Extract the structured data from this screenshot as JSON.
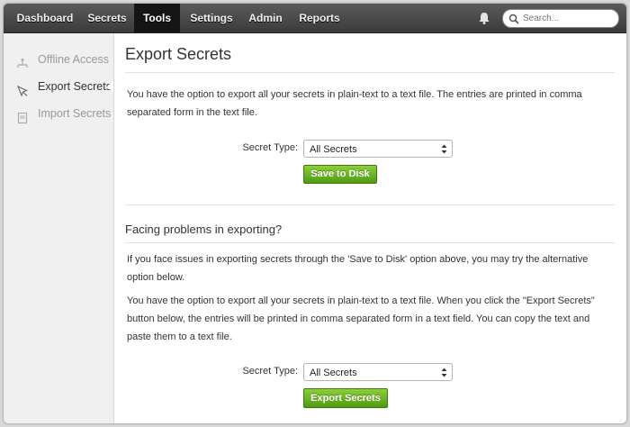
{
  "nav": {
    "items": [
      {
        "label": "Dashboard"
      },
      {
        "label": "Secrets"
      },
      {
        "label": "Tools"
      },
      {
        "label": "Settings"
      },
      {
        "label": "Admin"
      },
      {
        "label": "Reports"
      }
    ],
    "active": "Tools",
    "search_placeholder": "Search..."
  },
  "sidebar": {
    "items": [
      {
        "label": "Offline Access",
        "icon": "offline-access-icon"
      },
      {
        "label": "Export Secrets",
        "icon": "export-icon"
      },
      {
        "label": "Import Secrets",
        "icon": "import-icon"
      }
    ],
    "active": "Export Secrets"
  },
  "main": {
    "title": "Export Secrets",
    "intro": "You have the option to export all your secrets in plain-text to a text file. The entries are printed in comma separated form in the text file.",
    "form1": {
      "label": "Secret Type:",
      "selected": "All Secrets",
      "button": "Save to Disk"
    },
    "problems_title": "Facing problems in exporting?",
    "problems_p1": "If you face issues in exporting secrets through the 'Save to Disk' option above, you may try the alternative option below.",
    "problems_p2": "You have the option to export all your secrets in plain-text to a text file. When you click the \"Export Secrets\" button below, the entries will be printed in comma separated form in a text field. You can copy the text and paste them to a text file.",
    "form2": {
      "label": "Secret Type:",
      "selected": "All Secrets",
      "button": "Export Secrets"
    }
  },
  "colors": {
    "topbar": "#3b3b3b",
    "button_green": "#5fa91c",
    "sidebar_bg": "#f0f0f0"
  }
}
